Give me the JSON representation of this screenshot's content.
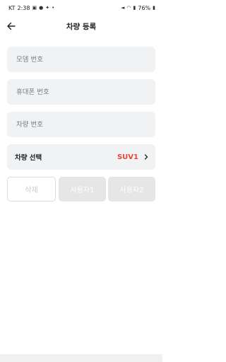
{
  "status_bar": {
    "carrier": "KT",
    "time": "2:38",
    "battery": "76%"
  },
  "app_bar": {
    "title": "차량 등록"
  },
  "form": {
    "model_placeholder": "모뎀 번호",
    "phone_placeholder": "휴대폰 번호",
    "vehicle_placeholder": "차량 번호",
    "vehicle_select": {
      "label": "차량 선택",
      "value": "SUV1"
    }
  },
  "buttons": {
    "delete": "삭제",
    "user1": "사용자1",
    "user2": "사용자2"
  },
  "colors": {
    "accent": "#e8472e",
    "field_bg": "#f1f2f4",
    "disabled_bg": "#e6e6e6"
  },
  "icons": {
    "back": "arrow-left-icon",
    "select_chevron": "chevron-right-icon"
  }
}
